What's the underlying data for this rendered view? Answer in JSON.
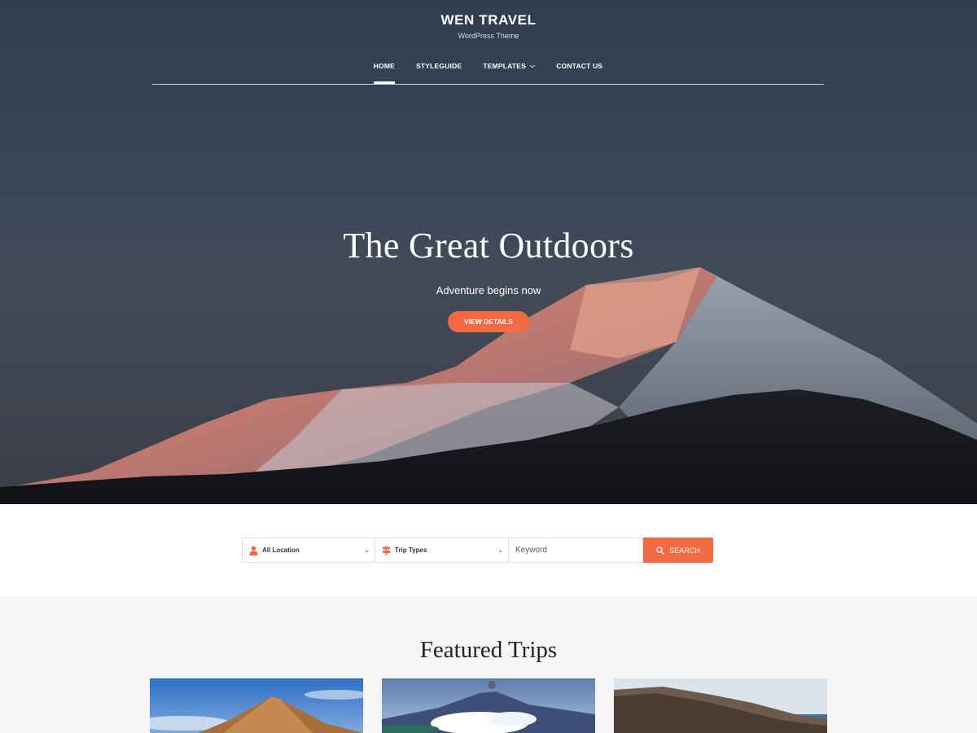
{
  "site": {
    "title": "WEN TRAVEL",
    "tagline": "WordPress Theme"
  },
  "nav": {
    "items": [
      {
        "label": "HOME",
        "active": true
      },
      {
        "label": "STYLEGUIDE"
      },
      {
        "label": "TEMPLATES",
        "has_dropdown": true
      },
      {
        "label": "CONTACT US"
      }
    ]
  },
  "hero": {
    "title": "The Great Outdoors",
    "subtitle": "Adventure begins now",
    "button_label": "VIEW DETAILS"
  },
  "search": {
    "location": {
      "selected": "All Location",
      "icon": "person-pin-icon"
    },
    "trip_type": {
      "selected": "Trip Types",
      "icon": "signpost-icon"
    },
    "keyword": {
      "placeholder": "Keyword"
    },
    "button_label": "SEARCH",
    "button_icon": "search-icon"
  },
  "featured": {
    "title": "Featured Trips"
  },
  "colors": {
    "accent": "#f26a43",
    "hero_sky": "#34414f",
    "section_bg": "#f5f5f5"
  }
}
